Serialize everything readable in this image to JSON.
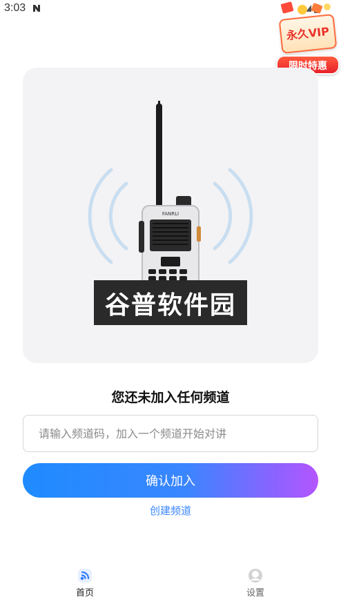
{
  "status_bar": {
    "time": "3:03"
  },
  "vip_badge": {
    "title": "永久VIP",
    "ribbon": "限时特惠"
  },
  "hero": {
    "radio_brand": "FANRLI",
    "watermark": "谷普软件园"
  },
  "main": {
    "empty_title": "您还未加入任何频道",
    "channel_input_placeholder": "请输入频道码，加入一个频道开始对讲",
    "channel_input_value": "",
    "confirm_button_label": "确认加入",
    "create_channel_label": "创建频道"
  },
  "bottom_nav": {
    "items": [
      {
        "label": "首页",
        "icon": "radio-wave-icon",
        "active": true
      },
      {
        "label": "设置",
        "icon": "user-avatar-icon",
        "active": false
      }
    ]
  },
  "colors": {
    "accent_blue": "#3a86ff",
    "accent_purple": "#b455ff",
    "vip_red": "#e8322b"
  }
}
